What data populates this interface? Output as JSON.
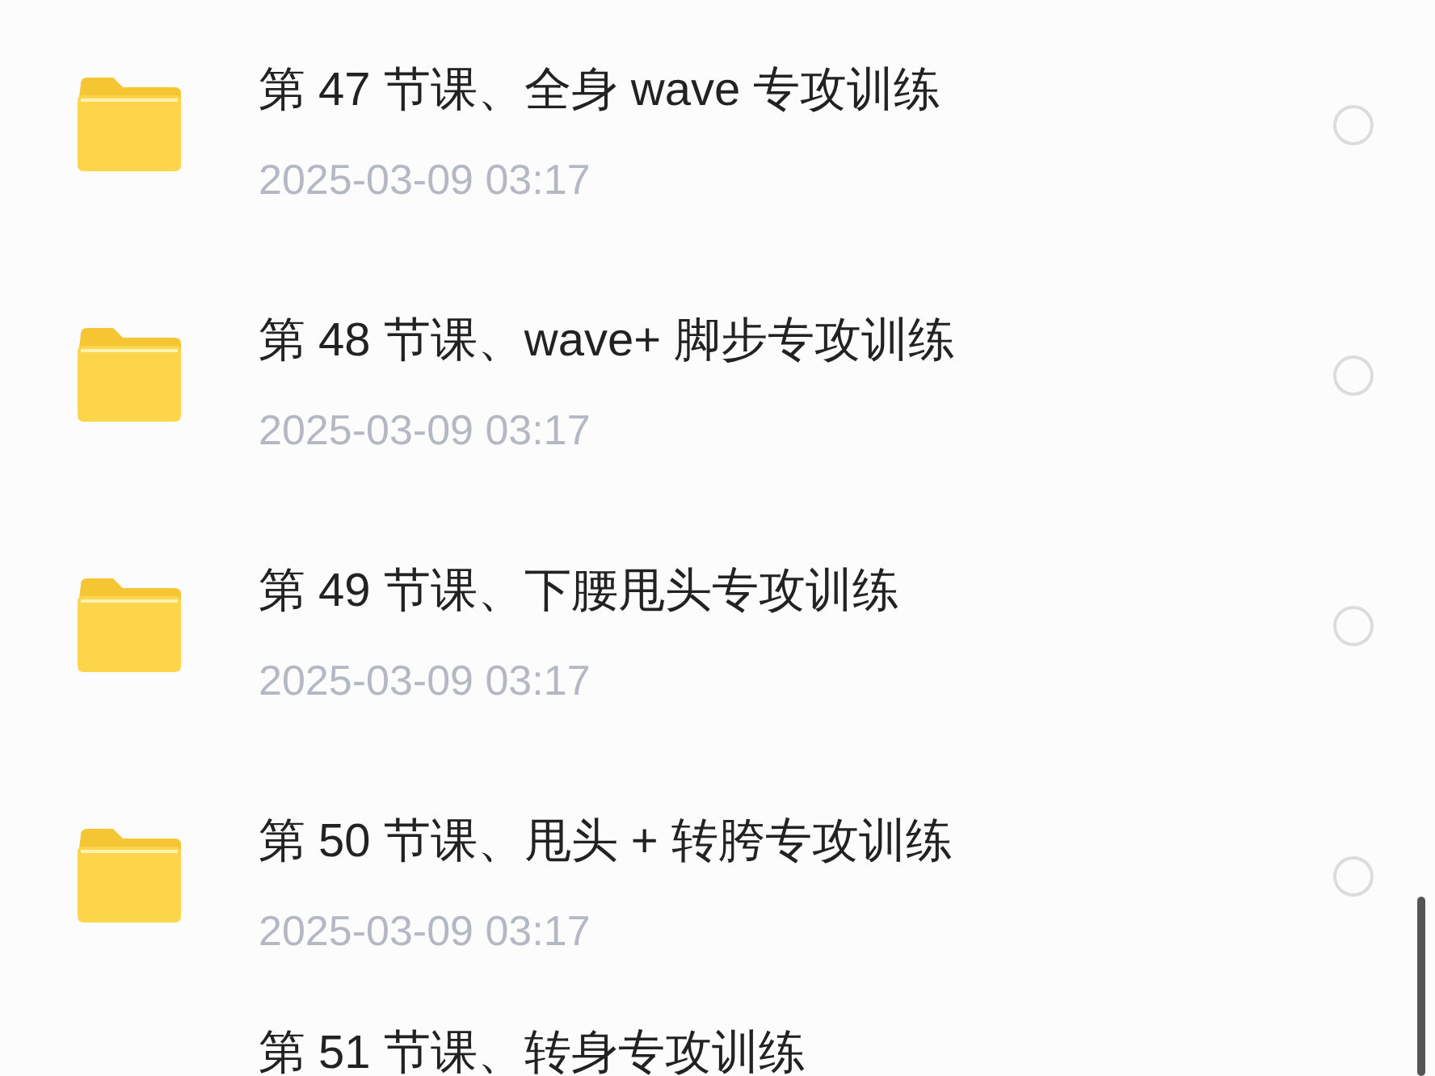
{
  "files": [
    {
      "title": "第 47 节课、全身 wave 专攻训练",
      "date": "2025-03-09 03:17",
      "selected": false
    },
    {
      "title": "第 48 节课、wave+ 脚步专攻训练",
      "date": "2025-03-09 03:17",
      "selected": false
    },
    {
      "title": "第 49 节课、下腰甩头专攻训练",
      "date": "2025-03-09 03:17",
      "selected": false
    },
    {
      "title": "第 50 节课、甩头 + 转胯专攻训练",
      "date": "2025-03-09 03:17",
      "selected": false
    },
    {
      "title": "第 51 节课、转身专攻训练"
    }
  ]
}
